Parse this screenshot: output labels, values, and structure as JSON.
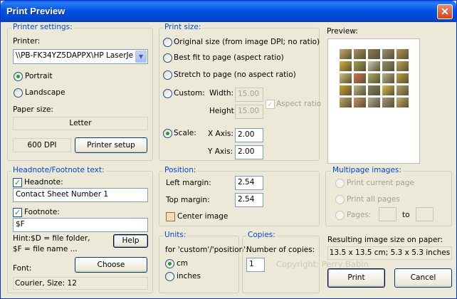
{
  "window": {
    "title": "Print Preview"
  },
  "printer_settings": {
    "legend": "Printer settings:",
    "printer_label": "Printer:",
    "printer_value": "\\\\PB-FK34YZ5DAPPX\\HP LaserJe",
    "portrait": "Portrait",
    "landscape": "Landscape",
    "orientation_selected": "Portrait",
    "paper_size_label": "Paper size:",
    "paper_size": "Letter",
    "dpi": "600 DPI",
    "printer_setup": "Printer setup"
  },
  "print_size": {
    "legend": "Print size:",
    "original": "Original size (from image DPI; no ratio)",
    "best_fit": "Best fit to page (aspect ratio)",
    "stretch": "Stretch to page (no aspect ratio)",
    "custom": "Custom:",
    "width_label": "Width:",
    "width_value": "15.00",
    "height_label": "Height:",
    "height_value": "15.00",
    "aspect_ratio": "Aspect ratio",
    "scale": "Scale:",
    "x_axis_label": "X Axis:",
    "x_axis_value": "2.00",
    "y_axis_label": "Y Axis:",
    "y_axis_value": "2.00",
    "selected": "Scale"
  },
  "preview": {
    "label": "Preview:",
    "thumb_colors": [
      "#c8a870",
      "#a89060",
      "#8a7858",
      "#9a9078",
      "#b89050",
      "#d8b040",
      "#a0a050",
      "#c8c8b8",
      "#909070",
      "#c0a060",
      "#d0c080",
      "#d87050",
      "#a8b060",
      "#c0b090",
      "#c8a040",
      "#d0a030",
      "#b8b890",
      "#808060",
      "#d8c050",
      "#b8a070",
      "#c0a870",
      "#d09060",
      "#b0b0a0",
      "#a89880",
      "#c8b060"
    ]
  },
  "headnote": {
    "legend": "Headnote/Footnote text:",
    "headnote_label": "Headnote:",
    "headnote_checked": true,
    "headnote_value": "Contact Sheet Number 1",
    "footnote_label": "Footnote:",
    "footnote_checked": true,
    "footnote_value": "$F",
    "hint_line1": "Hint:$D = file folder,",
    "hint_line2": "$F = file name ...",
    "help": "Help",
    "font_label": "Font:",
    "choose": "Choose",
    "font_value": "Courier, Size: 12"
  },
  "position": {
    "legend": "Position:",
    "left_margin_label": "Left margin:",
    "left_margin_value": "2.54",
    "top_margin_label": "Top margin:",
    "top_margin_value": "2.54",
    "center_image": "Center image",
    "center_checked": false
  },
  "multipage": {
    "legend": "Multipage images:",
    "current": "Print current page",
    "all": "Print all pages",
    "pages": "Pages:",
    "to": "to"
  },
  "units": {
    "legend": "Units:",
    "desc": "for 'custom'/'position':",
    "cm": "cm",
    "inches": "inches",
    "selected": "cm"
  },
  "copies": {
    "legend": "Copies:",
    "label": "Number of copies:",
    "value": "1"
  },
  "result": {
    "label": "Resulting image size on paper:",
    "value": "13.5 x 13.5 cm; 5.3 x 5.3 inches"
  },
  "copyright": "Copyright: Perry Babin",
  "buttons": {
    "print": "Print",
    "cancel": "Cancel"
  }
}
